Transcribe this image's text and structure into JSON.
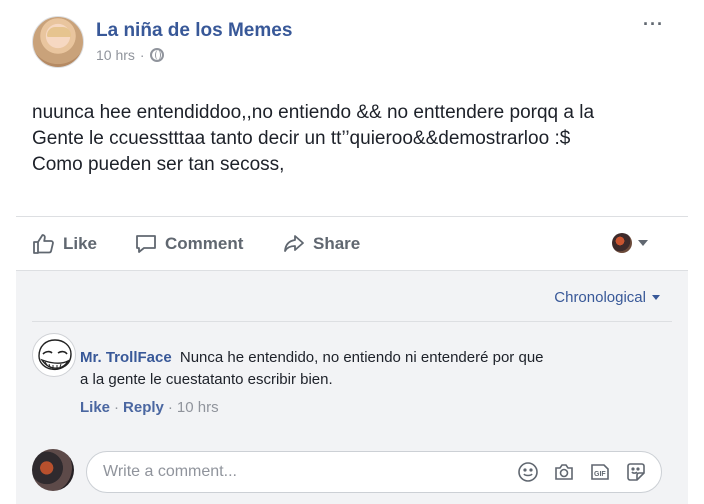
{
  "post": {
    "page_name": "La niña de los Memes",
    "time": "10 hrs",
    "separator": "·",
    "text_lines": [
      "nuunca hee entendiddoo,,no entiendo && no enttendere porqq a la",
      "Gente le ccuesstttaa tanto decir un tt’’quieroo&&demostrarloo :$",
      "Como pueden ser tan secoss,"
    ],
    "more": "···"
  },
  "actions": {
    "like": "Like",
    "comment": "Comment",
    "share": "Share"
  },
  "comments": {
    "sort_label": "Chronological",
    "items": [
      {
        "author": "Mr. TrollFace",
        "text_line1": "Nunca he entendido, no entiendo ni entenderé por que",
        "text_line2": "a la gente le cuestatanto escribir bien.",
        "like": "Like",
        "reply": "Reply",
        "time": "10 hrs",
        "sep": "·"
      }
    ],
    "composer_placeholder": "Write a comment..."
  },
  "colors": {
    "link": "#385898",
    "muted": "#90949c",
    "text": "#1d2129",
    "panel": "#f2f3f5"
  },
  "icons": [
    "globe-icon",
    "more-icon",
    "like-icon",
    "comment-icon",
    "share-icon",
    "caret-down-icon",
    "emoji-icon",
    "camera-icon",
    "gif-icon",
    "sticker-icon"
  ]
}
